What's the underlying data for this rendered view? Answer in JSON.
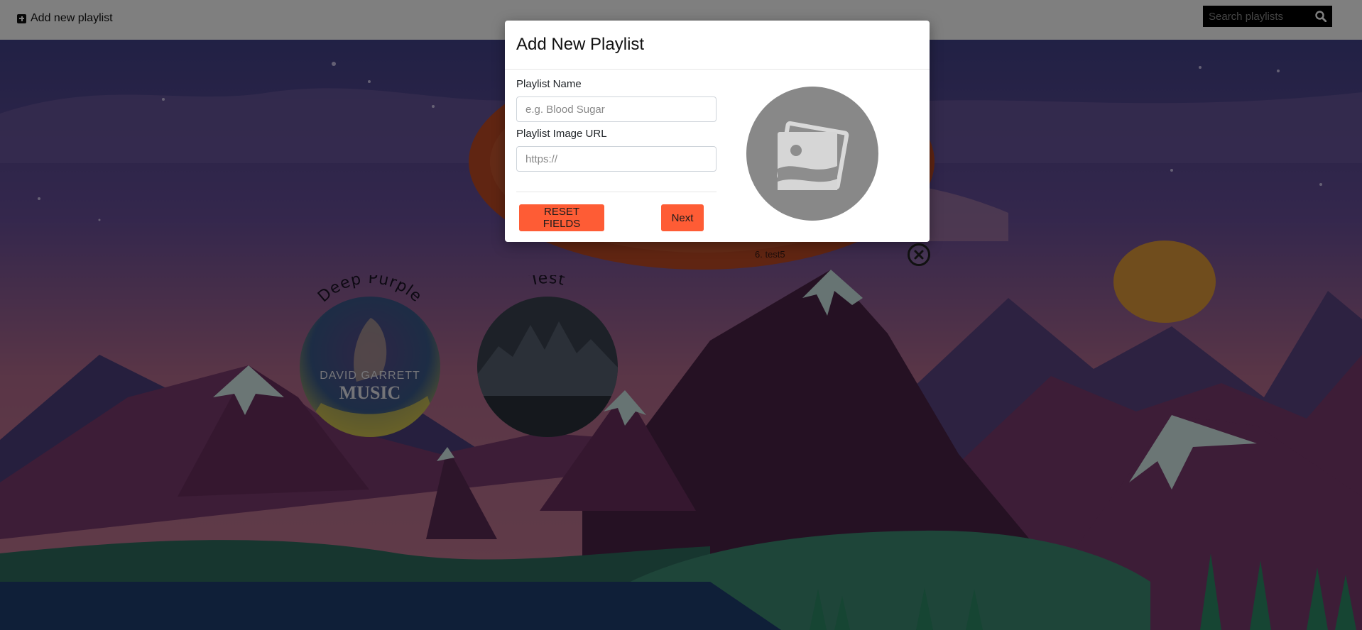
{
  "topbar": {
    "add_label": "Add new playlist",
    "search_placeholder": "Search playlists"
  },
  "playlists": [
    {
      "title": "Deep Purple",
      "cover_text_1": "DAVID GARRETT",
      "cover_text_2": "MUSIC"
    },
    {
      "title": "Test"
    }
  ],
  "featured": {
    "track_label": "6. test5"
  },
  "modal": {
    "title": "Add New Playlist",
    "name_label": "Playlist Name",
    "name_placeholder": "e.g. Blood Sugar",
    "image_label": "Playlist Image URL",
    "image_placeholder": "https://",
    "reset_label": "RESET FIELDS",
    "next_label": "Next"
  },
  "colors": {
    "accent": "#fe5c35",
    "overlay": "#000000"
  }
}
